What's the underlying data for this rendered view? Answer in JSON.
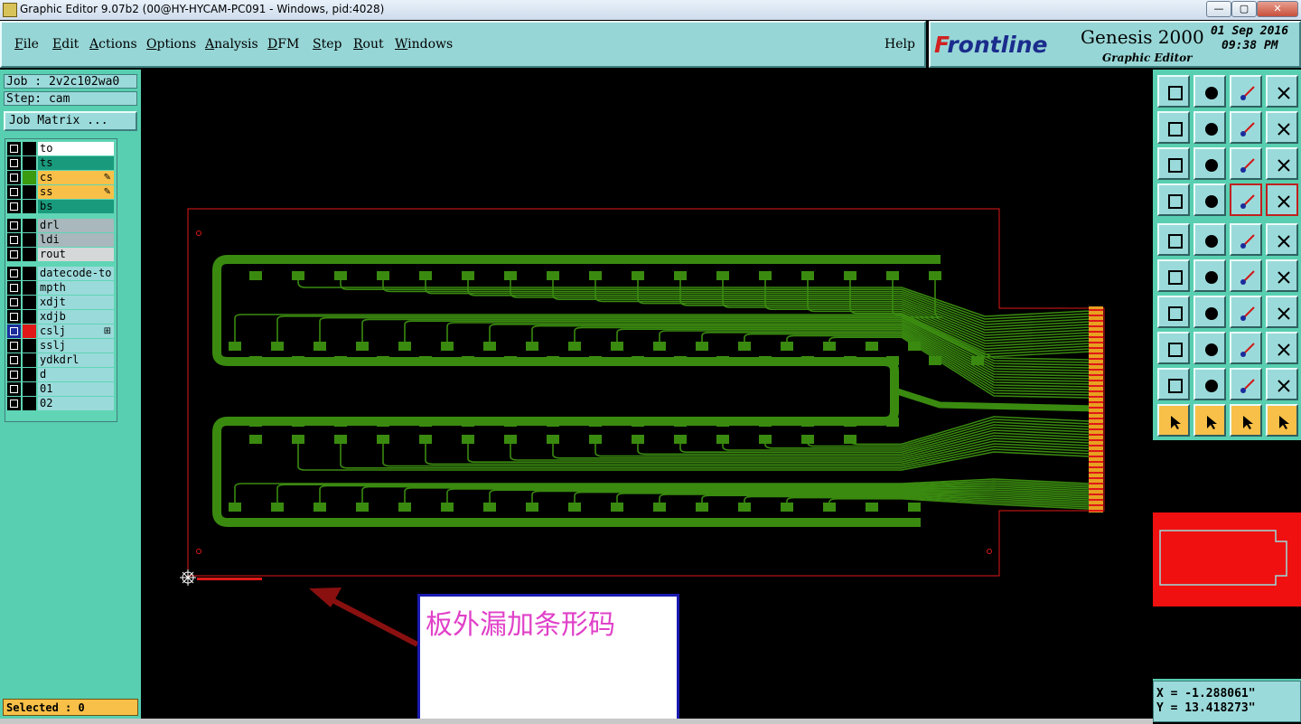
{
  "titlebar": {
    "title": "Graphic Editor 9.07b2 (00@HY-HYCAM-PC091 - Windows, pid:4028)",
    "min": "—",
    "max": "▢",
    "close": "✕"
  },
  "menu": [
    {
      "label": "File",
      "u": "F",
      "rest": "ile"
    },
    {
      "label": "Edit",
      "u": "E",
      "rest": "dit"
    },
    {
      "label": "Actions",
      "u": "A",
      "rest": "ctions"
    },
    {
      "label": "Options",
      "u": "O",
      "rest": "ptions"
    },
    {
      "label": "Analysis",
      "u": "A",
      "rest": "nalysis"
    },
    {
      "label": "DFM",
      "u": "D",
      "rest": "FM"
    },
    {
      "label": "Step",
      "u": "S",
      "rest": "tep"
    },
    {
      "label": "Rout",
      "u": "R",
      "rest": "out"
    },
    {
      "label": "Windows",
      "u": "W",
      "rest": "indows"
    }
  ],
  "help": "Help",
  "brand": {
    "logo_f": "F",
    "logo_rest": "rontline",
    "product": "Genesis 2000",
    "subtitle": "Graphic Editor",
    "date": "01 Sep 2016",
    "time": "09:38 PM"
  },
  "job": {
    "job_label": "Job : 2v2c102wa0",
    "step_label": "Step: cam",
    "matrix_button": "Job Matrix ..."
  },
  "layers": [
    {
      "name": "to",
      "bg": "#ffffff",
      "swatch": "#000000",
      "mark": ""
    },
    {
      "name": "ts",
      "bg": "#1a9a7c",
      "swatch": "#000000",
      "mark": ""
    },
    {
      "name": "cs",
      "bg": "#f8c048",
      "swatch": "#3a9a10",
      "mark": "✎"
    },
    {
      "name": "ss",
      "bg": "#f8c048",
      "swatch": "#000000",
      "mark": "✎"
    },
    {
      "name": "bs",
      "bg": "#1a9a7c",
      "swatch": "#000000",
      "mark": ""
    },
    {
      "name": "drl",
      "bg": "#a8b8bc",
      "swatch": "#000000",
      "mark": ""
    },
    {
      "name": "ldi",
      "bg": "#a8b8bc",
      "swatch": "#000000",
      "mark": ""
    },
    {
      "name": "rout",
      "bg": "#d4d8d8",
      "swatch": "#000000",
      "mark": ""
    },
    {
      "name": "datecode-to",
      "bg": "#9bdada",
      "swatch": "#000000",
      "mark": ""
    },
    {
      "name": "mpth",
      "bg": "#9bdada",
      "swatch": "#000000",
      "mark": ""
    },
    {
      "name": "xdjt",
      "bg": "#9bdada",
      "swatch": "#000000",
      "mark": ""
    },
    {
      "name": "xdjb",
      "bg": "#9bdada",
      "swatch": "#000000",
      "mark": ""
    },
    {
      "name": "cslj",
      "bg": "#9bdada",
      "swatch": "#e01818",
      "mark": "⊞"
    },
    {
      "name": "sslj",
      "bg": "#9bdada",
      "swatch": "#000000",
      "mark": ""
    },
    {
      "name": "ydkdrl",
      "bg": "#9bdada",
      "swatch": "#000000",
      "mark": ""
    },
    {
      "name": "d",
      "bg": "#9bdada",
      "swatch": "#000000",
      "mark": ""
    },
    {
      "name": "01",
      "bg": "#9bdada",
      "swatch": "#000000",
      "mark": ""
    },
    {
      "name": "02",
      "bg": "#9bdada",
      "swatch": "#000000",
      "mark": ""
    }
  ],
  "selected": "Selected : 0",
  "coords": {
    "x": "X = -1.288061\"",
    "y": "Y = 13.418273\""
  },
  "annotation": "板外漏加条形码",
  "colors": {
    "panel": "#58cfb0",
    "copper": "#3a8a10",
    "profile": "#e01818",
    "accent_orange": "#f8c048"
  },
  "toolbar_icons": [
    "zoom-home-icon",
    "zoom-page-icon",
    "home-view-icon",
    "split-window-icon",
    "pan-left-icon",
    "pan-right-icon",
    "undo-view-icon",
    "redo-view-icon",
    "fit-screen-icon",
    "fit-zoom-icon",
    "scale-1to2-icon",
    "help-query-icon",
    "measure-tools-icon",
    "grid-icon",
    "snap-red-icon",
    "snap-red-alt-icon",
    "pad-select-icon",
    "profile-icon",
    "ruler-icon",
    "circle-fill-icon",
    "node-link-icon",
    "delete-node-icon",
    "point-add-icon",
    "point-move-icon",
    "angle-tool-icon",
    "line-tool-icon",
    "rotate-icon",
    "mirror-icon",
    "feature-move-icon",
    "line-split-icon",
    "resize-icon",
    "group-icon",
    "triangle-small-icon",
    "arc-tool-icon",
    "arc-select-icon",
    "arc-align-icon",
    "pointer-icon",
    "pointer-box-icon",
    "pointer-circle-icon",
    "pointer-custom-icon"
  ]
}
